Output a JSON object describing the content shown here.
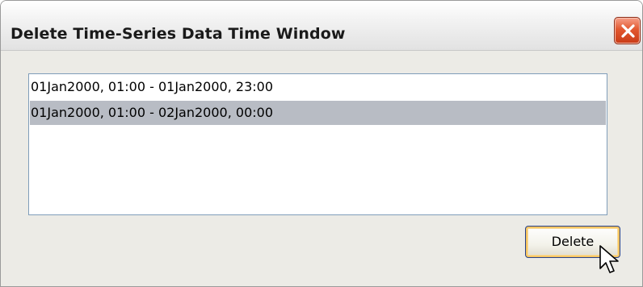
{
  "window": {
    "title": "Delete Time-Series Data Time Window",
    "close_icon": "close-icon"
  },
  "list": {
    "items": [
      {
        "label": "01Jan2000,  01:00 - 01Jan2000,  23:00",
        "selected": false
      },
      {
        "label": "01Jan2000,  01:00 - 02Jan2000,  00:00",
        "selected": true
      }
    ]
  },
  "actions": {
    "delete_label": "Delete"
  },
  "colors": {
    "selection": "#b8bcc4",
    "close_button": "#e2582f",
    "focus_ring": "#f5c563"
  },
  "pointer": {
    "icon": "arrow-cursor-icon"
  }
}
